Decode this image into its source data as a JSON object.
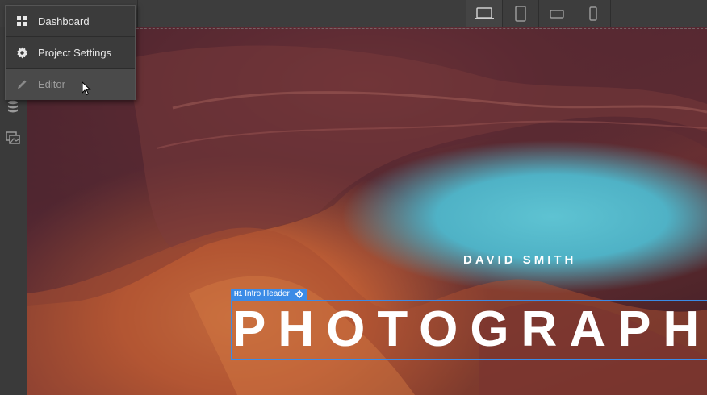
{
  "menu": {
    "items": [
      {
        "label": "Dashboard",
        "icon": "grid-icon"
      },
      {
        "label": "Project Settings",
        "icon": "gear-icon"
      },
      {
        "label": "Editor",
        "icon": "pencil-icon"
      }
    ]
  },
  "toolbar": {
    "devices": [
      "desktop-icon",
      "tablet-icon",
      "mobile-landscape-icon",
      "mobile-portrait-icon"
    ],
    "active_device": "desktop-icon"
  },
  "canvas": {
    "subtitle": "DAVID SMITH",
    "headline": "PHOTOGRAPH",
    "selected_element": {
      "tag": "H1",
      "label": "Intro Header"
    }
  },
  "colors": {
    "selection": "#3b8be6",
    "toolbar_bg": "#3d3d3d",
    "menu_bg": "#3b3b3b"
  }
}
